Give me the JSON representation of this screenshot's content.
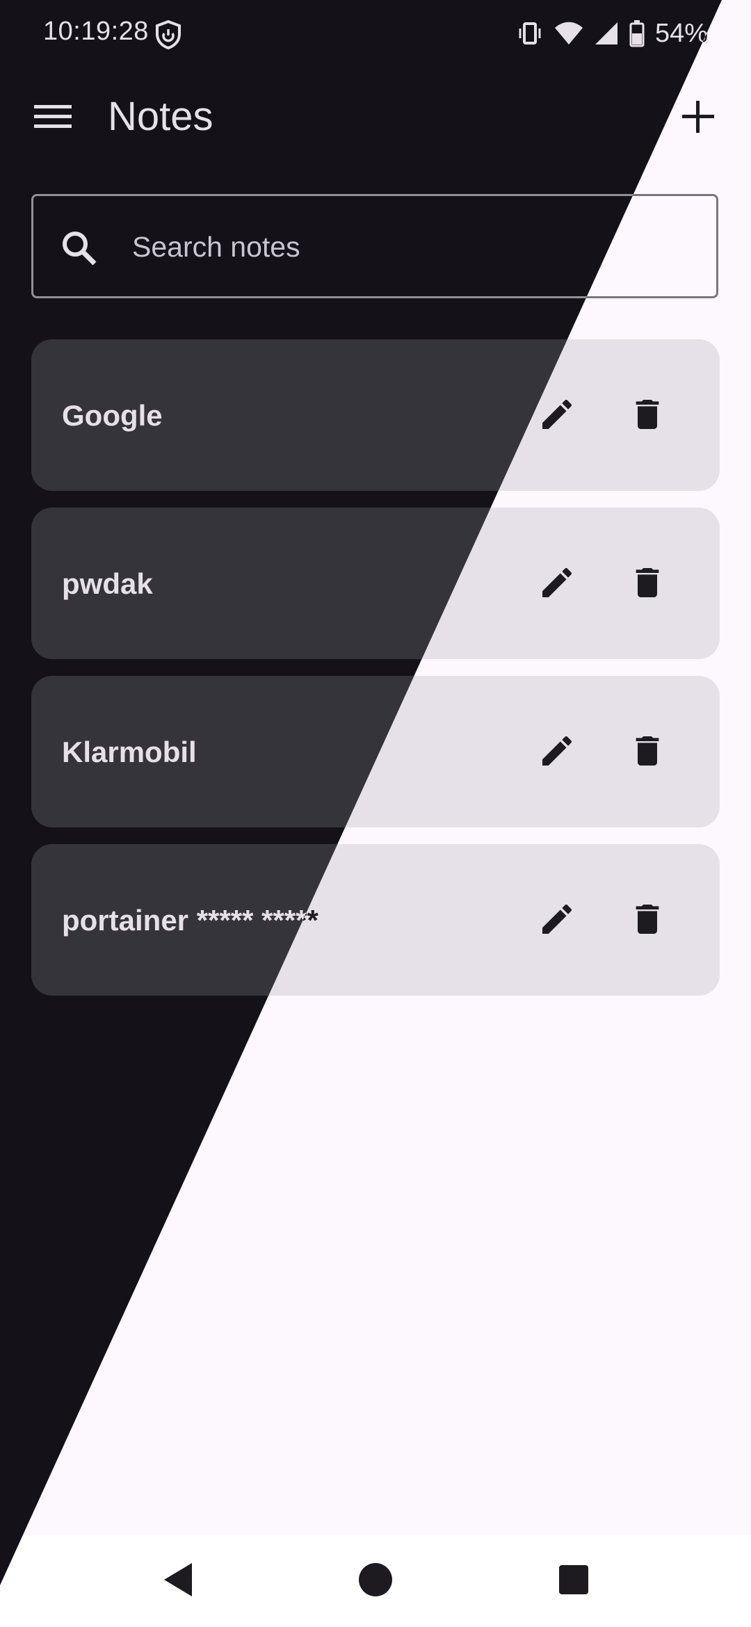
{
  "status_bar": {
    "time": "10:19:28",
    "battery_percent": "54%",
    "icons": [
      "vpn-shield-icon",
      "vibrate-icon",
      "wifi-icon",
      "signal-icon",
      "battery-icon"
    ]
  },
  "app_bar": {
    "title": "Notes",
    "menu_icon": "menu-icon",
    "add_icon": "add-icon"
  },
  "search": {
    "placeholder": "Search notes",
    "icon": "search-icon"
  },
  "notes": [
    {
      "title": "Google"
    },
    {
      "title": "pwdak"
    },
    {
      "title": "Klarmobil"
    },
    {
      "title": "portainer ***** *****"
    }
  ],
  "note_actions": {
    "edit_icon": "pencil-icon",
    "delete_icon": "trash-icon"
  },
  "nav_bar": {
    "back_icon": "back-icon",
    "home_icon": "home-icon",
    "recents_icon": "recents-icon"
  },
  "colors": {
    "dark_background": "#141218",
    "dark_card": "#36343b",
    "light_background": "#fdf7fe",
    "light_card": "#e6e0e9",
    "text_dark_theme": "#e6e0e9",
    "text_light_theme": "#1d1b20"
  }
}
